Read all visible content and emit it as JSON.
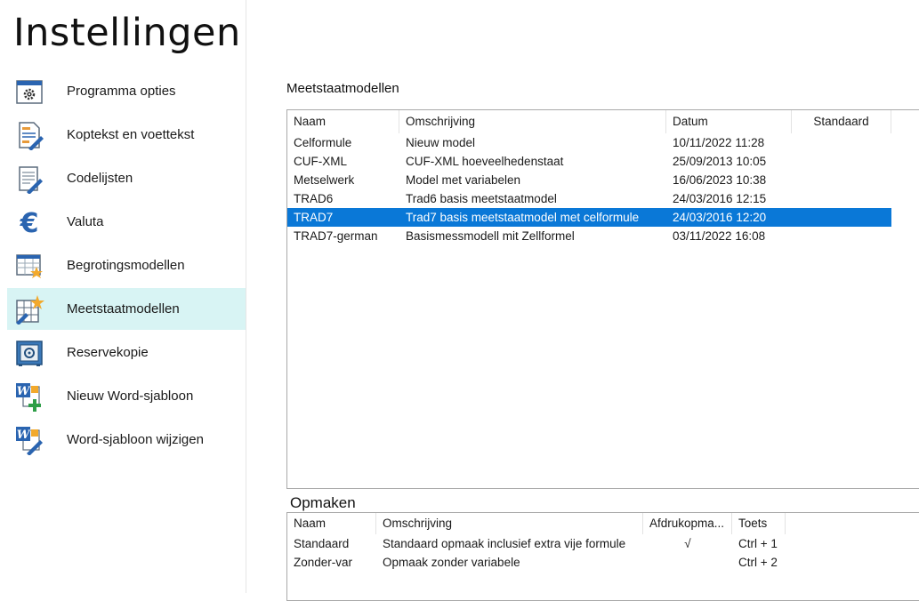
{
  "title": "Instellingen",
  "sidebar": {
    "items": [
      {
        "label": "Programma opties",
        "icon": "gear-window-icon",
        "active": false
      },
      {
        "label": "Koptekst en voettekst",
        "icon": "document-pen-icon",
        "active": false
      },
      {
        "label": "Codelijsten",
        "icon": "notepad-pen-icon",
        "active": false
      },
      {
        "label": "Valuta",
        "icon": "euro-icon",
        "active": false
      },
      {
        "label": "Begrotingsmodellen",
        "icon": "table-star-icon",
        "active": false
      },
      {
        "label": "Meetstaatmodellen",
        "icon": "grid-star-pen-icon",
        "active": true
      },
      {
        "label": "Reservekopie",
        "icon": "safe-icon",
        "active": false
      },
      {
        "label": "Nieuw Word-sjabloon",
        "icon": "word-plus-icon",
        "active": false
      },
      {
        "label": "Word-sjabloon wijzigen",
        "icon": "word-pen-icon",
        "active": false
      }
    ]
  },
  "meetstaat": {
    "label": "Meetstaatmodellen",
    "columns": [
      "Naam",
      "Omschrijving",
      "Datum",
      "Standaard"
    ],
    "rows": [
      {
        "naam": "Celformule",
        "omschrijving": "Nieuw model",
        "datum": "10/11/2022 11:28",
        "standaard": "",
        "selected": false
      },
      {
        "naam": "CUF-XML",
        "omschrijving": "CUF-XML hoeveelhedenstaat",
        "datum": "25/09/2013 10:05",
        "standaard": "",
        "selected": false
      },
      {
        "naam": "Metselwerk",
        "omschrijving": "Model met variabelen",
        "datum": "16/06/2023 10:38",
        "standaard": "",
        "selected": false
      },
      {
        "naam": "TRAD6",
        "omschrijving": "Trad6 basis meetstaatmodel",
        "datum": "24/03/2016 12:15",
        "standaard": "",
        "selected": false
      },
      {
        "naam": "TRAD7",
        "omschrijving": "Trad7 basis meetstaatmodel met celformule",
        "datum": "24/03/2016 12:20",
        "standaard": "",
        "selected": true
      },
      {
        "naam": "TRAD7-german",
        "omschrijving": "Basismessmodell mit Zellformel",
        "datum": "03/11/2022 16:08",
        "standaard": "",
        "selected": false
      }
    ]
  },
  "opmaken": {
    "label": "Opmaken",
    "columns": [
      "Naam",
      "Omschrijving",
      "Afdrukopma...",
      "Toets"
    ],
    "rows": [
      {
        "naam": "Standaard",
        "omschrijving": "Standaard opmaak inclusief extra vije formule",
        "afdruk": "√",
        "toets": "Ctrl + 1"
      },
      {
        "naam": "Zonder-var",
        "omschrijving": "Opmaak zonder variabele",
        "afdruk": "",
        "toets": "Ctrl + 2"
      }
    ]
  },
  "colors": {
    "selection": "#0a78d7",
    "active_nav": "#d8f4f4",
    "accent_blue": "#2a64b0",
    "star": "#f2a92c"
  }
}
